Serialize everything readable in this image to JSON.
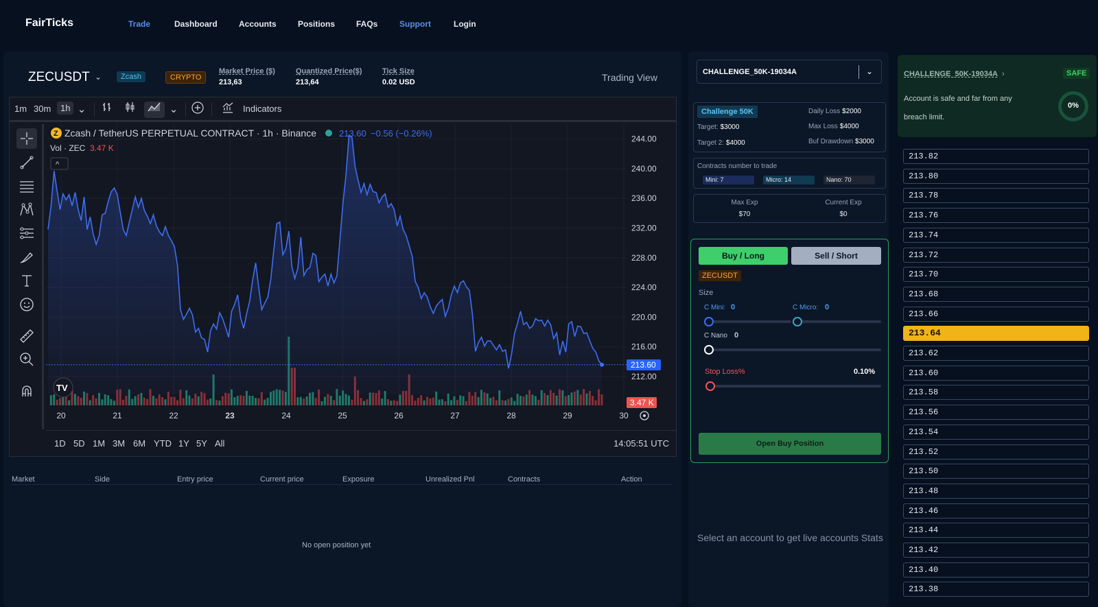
{
  "nav": {
    "brand": "FairTicks",
    "links": [
      "Trade",
      "Dashboard",
      "Accounts",
      "Positions",
      "FAQs",
      "Support",
      "Login"
    ],
    "active": "Trade",
    "accent_color": "#5b8fe8"
  },
  "header": {
    "symbol": "ZECUSDT",
    "coin_badge": "Zcash",
    "category_badge": "CRYPTO",
    "market_price_label": "Market Price ($)",
    "market_price": "213,63",
    "quantized_label": "Quantized Price($)",
    "quantized_price": "213,64",
    "tick_label": "Tick Size",
    "tick_size": "0.02 USD",
    "trading_view": "Trading View"
  },
  "chart_toolbar": {
    "timeframes": [
      "1m",
      "30m",
      "1h"
    ],
    "selected_timeframe": "1h",
    "indicators": "Indicators"
  },
  "chart_data": {
    "type": "area",
    "title": "Zcash / TetherUS PERPETUAL CONTRACT · 1h · Binance",
    "last_price": "213.60",
    "change": "−0.56 (−0.26%)",
    "volume_label": "Vol · ZEC",
    "volume_value": "3.47 K",
    "y_ticks": [
      "244.00",
      "240.00",
      "236.00",
      "232.00",
      "228.00",
      "224.00",
      "220.00",
      "216.00",
      "212.00"
    ],
    "ylim": [
      209.6,
      246.0
    ],
    "x_ticks": [
      "20",
      "21",
      "22",
      "23",
      "24",
      "25",
      "26",
      "27",
      "28",
      "29",
      "30"
    ],
    "price_tag": "213.60",
    "volume_tag": "3.47 K",
    "line_color": "#3f6ef0",
    "series": [
      {
        "values": [
          231.8,
          235.0,
          239.7,
          237.0,
          234.5,
          236.6,
          235.8,
          236.5,
          235.0,
          236.8,
          234.5,
          233.0,
          236.2,
          231.8,
          233.5,
          231.2,
          229.8,
          231.0,
          233.8,
          234.0,
          235.6,
          236.9,
          237.4,
          236.5,
          234.1,
          231.8,
          231.0,
          232.8,
          234.5,
          236.2,
          234.8,
          236.0,
          234.4,
          233.6,
          232.6,
          233.8,
          232.3,
          231.5,
          231.0,
          232.2,
          231.0,
          230.3,
          229.5,
          227.0,
          221.0,
          219.7,
          220.4,
          221.2,
          220.3,
          218.0,
          218.5,
          217.2,
          217.0,
          215.3,
          218.2,
          219.1,
          218.4,
          220.6,
          219.8,
          218.6,
          217.3,
          220.8,
          221.7,
          223.0,
          219.9,
          218.5,
          220.5,
          222.2,
          225.0,
          227.3,
          224.0,
          221.0,
          221.9,
          222.7,
          225.1,
          229.0,
          232.6,
          232.8,
          228.4,
          229.2,
          231.6,
          226.8,
          225.2,
          226.6,
          230.8,
          225.6,
          226.4,
          226.7,
          228.6,
          228.3,
          224.8,
          225.4,
          225.8,
          224.2,
          225.8,
          224.6,
          225.6,
          230.5,
          235.4,
          239.2,
          244.5,
          244.2,
          240.3,
          238.5,
          236.8,
          238.0,
          236.5,
          237.9,
          236.9,
          236.8,
          235.4,
          236.2,
          236.6,
          234.8,
          235.3,
          234.5,
          232.3,
          233.6,
          231.8,
          231.0,
          229.6,
          228.2,
          224.8,
          224.0,
          222.5,
          223.3,
          222.7,
          221.4,
          220.5,
          221.5,
          222.0,
          222.4,
          220.1,
          221.2,
          223.0,
          224.2,
          223.3,
          224.6,
          224.9,
          224.1,
          223.6,
          220.4,
          215.4,
          216.6,
          217.3,
          216.1,
          216.8,
          216.8,
          216.2,
          215.6,
          216.3,
          215.4,
          215.6,
          213.1,
          215.0,
          217.8,
          219.2,
          220.8,
          219.0,
          219.3,
          218.5,
          218.8,
          219.8,
          219.5,
          219.6,
          218.8,
          219.6,
          219.0,
          217.1,
          217.9,
          214.9,
          216.8,
          215.3,
          219.1,
          219.4,
          217.4,
          218.8,
          218.7,
          217.8,
          217.9,
          216.8,
          215.8,
          215.3,
          214.1,
          213.6
        ]
      }
    ],
    "volume_note": "volume bars colored green (up) / red (down)",
    "grid": true
  },
  "draw_tools": [
    "crosshair-icon",
    "trendline-icon",
    "fib-icon",
    "pattern-icon",
    "projection-icon",
    "brush-icon",
    "text-icon",
    "emoji-icon",
    "ruler-icon",
    "zoom-icon",
    "magnet-icon"
  ],
  "range_buttons": [
    "1D",
    "5D",
    "1M",
    "3M",
    "6M",
    "YTD",
    "1Y",
    "5Y",
    "All"
  ],
  "clock": "14:05:51 UTC",
  "positions": {
    "columns": [
      "Market",
      "Side",
      "Entry price",
      "Current price",
      "Exposure",
      "Unrealized Pnl",
      "Contracts",
      "Action"
    ],
    "empty": "No open position yet"
  },
  "account": {
    "selected": "CHALLENGE_50K-19034A",
    "challenge_badge": "Challenge 50K",
    "target_label": "Target:",
    "target": "$3000",
    "target2_label": "Target 2:",
    "target2": "$4000",
    "daily_loss_label": "Daily Loss",
    "daily_loss": "$2000",
    "max_loss_label": "Max Loss",
    "max_loss": "$4000",
    "buf_label": "Buf Drawdown",
    "buf": "$3000",
    "contracts_label": "Contracts number to trade",
    "mini": "Mini: 7",
    "micro": "Micro: 14",
    "nano": "Nano: 70",
    "max_exp_label": "Max Exp",
    "max_exp": "$70",
    "current_exp_label": "Current Exp",
    "current_exp": "$0"
  },
  "order": {
    "buy": "Buy / Long",
    "sell": "Sell / Short",
    "symbol": "ZECUSDT",
    "size_label": "Size",
    "mini_label": "C Mini:",
    "mini_val": "0",
    "micro_label": "C Micro:",
    "micro_val": "0",
    "nano_label": "C Nano",
    "nano_val": "0",
    "stoploss_label": "Stop Loss%",
    "stoploss_val": "0.10%",
    "submit": "Open Buy Position"
  },
  "live_stats_msg": "Select an account to get live accounts Stats",
  "safety": {
    "account": "CHALLENGE_50K-19034A",
    "status": "SAFE",
    "message": "Account is safe and far from any breach limit.",
    "percent": "0%"
  },
  "ladder": {
    "prices": [
      "213.82",
      "213.80",
      "213.78",
      "213.76",
      "213.74",
      "213.72",
      "213.70",
      "213.68",
      "213.66",
      "213.64",
      "213.62",
      "213.60",
      "213.58",
      "213.56",
      "213.54",
      "213.52",
      "213.50",
      "213.48",
      "213.46",
      "213.44",
      "213.42",
      "213.40",
      "213.38"
    ],
    "current": "213.64"
  }
}
